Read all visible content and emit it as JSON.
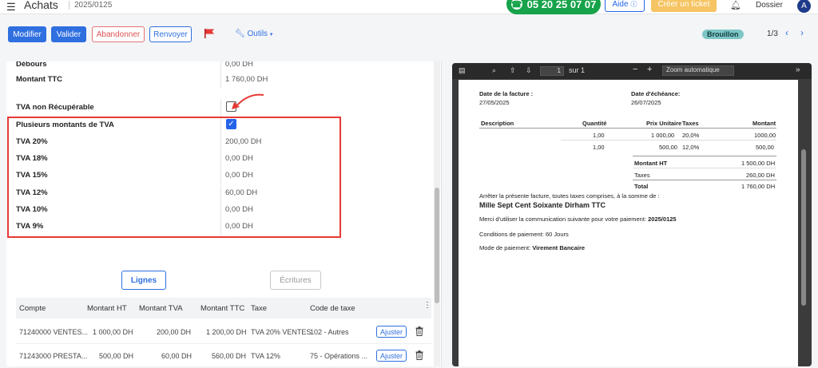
{
  "header": {
    "app_title": "Achats",
    "breadcrumb": "2025/0125",
    "phone": "05 20 25 07 07",
    "help_label": "Aide",
    "ticket_label": "Créer un ticket",
    "dossier_label": "Dossier",
    "avatar_initial": "A"
  },
  "toolbar": {
    "modify_label": "Modifier",
    "validate_label": "Valider",
    "abandon_label": "Abandonner",
    "resend_label": "Renvoyer",
    "tools_label": "Outils",
    "status": "Brouillon",
    "pager": "1/3",
    "flag_color": "#e53935"
  },
  "form": {
    "rows": [
      {
        "label": "Débours",
        "value": "0,00 DH"
      },
      {
        "label": "Montant TTC",
        "value": "1 760,00 DH"
      }
    ],
    "non_recoverable_label": "TVA non Récupérable",
    "multi_vat_label": "Plusieurs montants de TVA",
    "vat_rows": [
      {
        "label": "TVA 20%",
        "value": "200,00 DH"
      },
      {
        "label": "TVA 18%",
        "value": "0,00 DH"
      },
      {
        "label": "TVA 15%",
        "value": "0,00 DH"
      },
      {
        "label": "TVA 12%",
        "value": "60,00 DH"
      },
      {
        "label": "TVA 10%",
        "value": "0,00 DH"
      },
      {
        "label": "TVA 9%",
        "value": "0,00 DH"
      }
    ]
  },
  "tabs": {
    "lines_label": "Lignes",
    "entries_label": "Écritures"
  },
  "table": {
    "headers": [
      "Compte",
      "Montant HT",
      "Montant TVA",
      "Montant TTC",
      "Taxe",
      "Code de taxe"
    ],
    "adjust_label": "Ajuster",
    "rows": [
      [
        "71240000 VENTES...",
        "1 000,00 DH",
        "200,00 DH",
        "1 200,00 DH",
        "TVA 20% VENTES",
        "102 - Autres"
      ],
      [
        "71243000 PRESTA...",
        "500,00 DH",
        "60,00 DH",
        "560,00 DH",
        "TVA 12%",
        "75 - Opérations ..."
      ]
    ]
  },
  "pdf": {
    "page_current": "1",
    "page_total": "sur 1",
    "zoom": "Zoom automatique",
    "invoice_date_label": "Date de la facture :",
    "invoice_date": "27/05/2025",
    "due_date_label": "Date d'échéance:",
    "due_date": "26/07/2025",
    "col_description": "Description",
    "col_quantity": "Quantité",
    "col_unit_price": "Prix Unitaire",
    "col_taxes": "Taxes",
    "col_amount": "Montant",
    "items": [
      {
        "qty": "1,00",
        "price": "1 000,00",
        "tax": "20,0%",
        "amount": "1000,00"
      },
      {
        "qty": "1,00",
        "price": "500,00",
        "tax": "12,0%",
        "amount": "500,00"
      }
    ],
    "total_ht_label": "Montant HT",
    "total_ht": "1 500,00 DH",
    "taxes_label": "Taxes",
    "taxes": "260,00 DH",
    "total_label": "Total",
    "total": "1 760,00 DH",
    "stop_text": "Arrêter la présente facture, toutes taxes comprises, à la somme de :",
    "amount_words": "Mille Sept Cent Soixante Dirham TTC",
    "ref_text": "Merci d'utiliser la communication suivante pour votre paiement:",
    "ref_value": "2025/0125",
    "payment_terms": "Conditions de paiement: 60 Jours",
    "payment_mode_label": "Mode de paiement:",
    "payment_mode": "Virement Bancaire"
  }
}
